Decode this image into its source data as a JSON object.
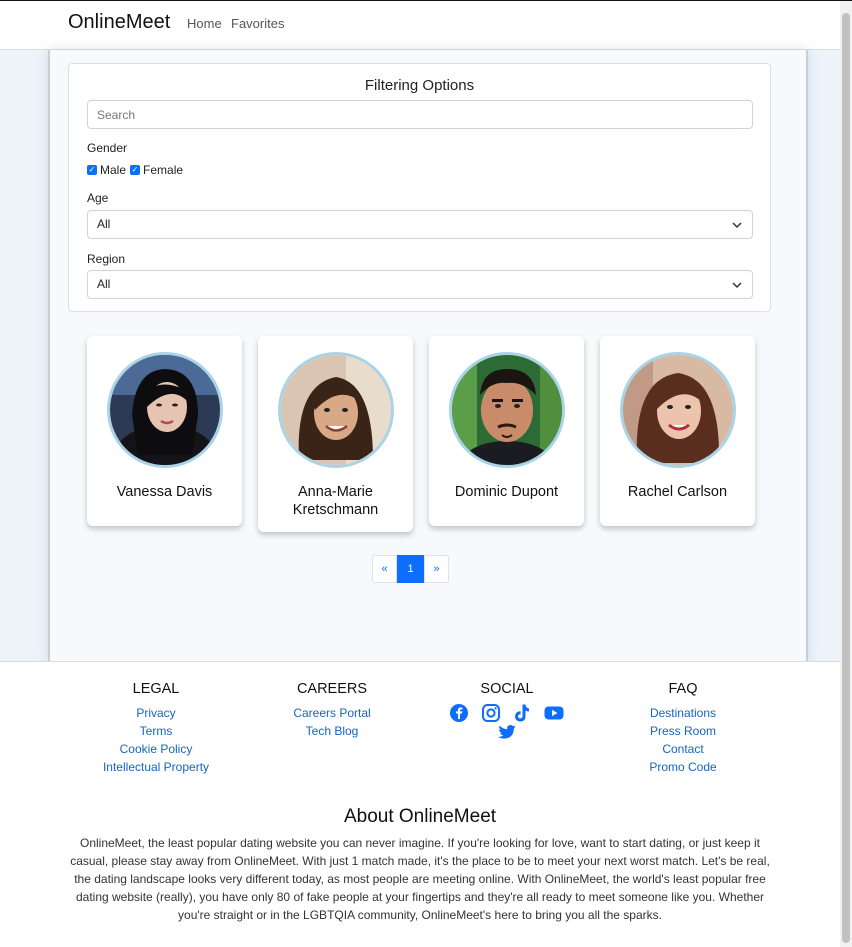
{
  "navbar": {
    "brand": "OnlineMeet",
    "links": [
      "Home",
      "Favorites"
    ]
  },
  "filter": {
    "title": "Filtering Options",
    "search_placeholder": "Search",
    "gender_label": "Gender",
    "gender_options": [
      {
        "label": "Male",
        "checked": true
      },
      {
        "label": "Female",
        "checked": true
      }
    ],
    "age_label": "Age",
    "age_value": "All",
    "region_label": "Region",
    "region_value": "All"
  },
  "profiles": [
    {
      "name": "Vanessa Davis"
    },
    {
      "name": "Anna-Marie Kretschmann"
    },
    {
      "name": "Dominic Dupont"
    },
    {
      "name": "Rachel Carlson"
    }
  ],
  "pagination": {
    "prev": "«",
    "current": "1",
    "next": "»"
  },
  "footer": {
    "legal": {
      "title": "LEGAL",
      "links": [
        "Privacy",
        "Terms",
        "Cookie Policy",
        "Intellectual Property"
      ]
    },
    "careers": {
      "title": "CAREERS",
      "links": [
        "Careers Portal",
        "Tech Blog"
      ]
    },
    "social": {
      "title": "SOCIAL",
      "icons": [
        "facebook-icon",
        "instagram-icon",
        "tiktok-icon",
        "youtube-icon",
        "twitter-icon"
      ]
    },
    "faq": {
      "title": "FAQ",
      "links": [
        "Destinations",
        "Press Room",
        "Contact",
        "Promo Code"
      ]
    }
  },
  "about": {
    "title": "About OnlineMeet",
    "text": "OnlineMeet, the least popular dating website you can never imagine. If you're looking for love, want to start dating, or just keep it casual, please stay away from OnlineMeet. With just 1 match made, it's the place to be to meet your next worst match. Let's be real, the dating landscape looks very different today, as most people are meeting online. With OnlineMeet, the world's least popular free dating website (really), you have only 80 of fake people at your fingertips and they're all ready to meet someone like you. Whether you're straight or in the LGBTQIA community, OnlineMeet's here to bring you all the sparks."
  },
  "colors": {
    "primary": "#0d6efd",
    "link": "#1565c0",
    "avatar_ring": "#a9d3e6"
  }
}
